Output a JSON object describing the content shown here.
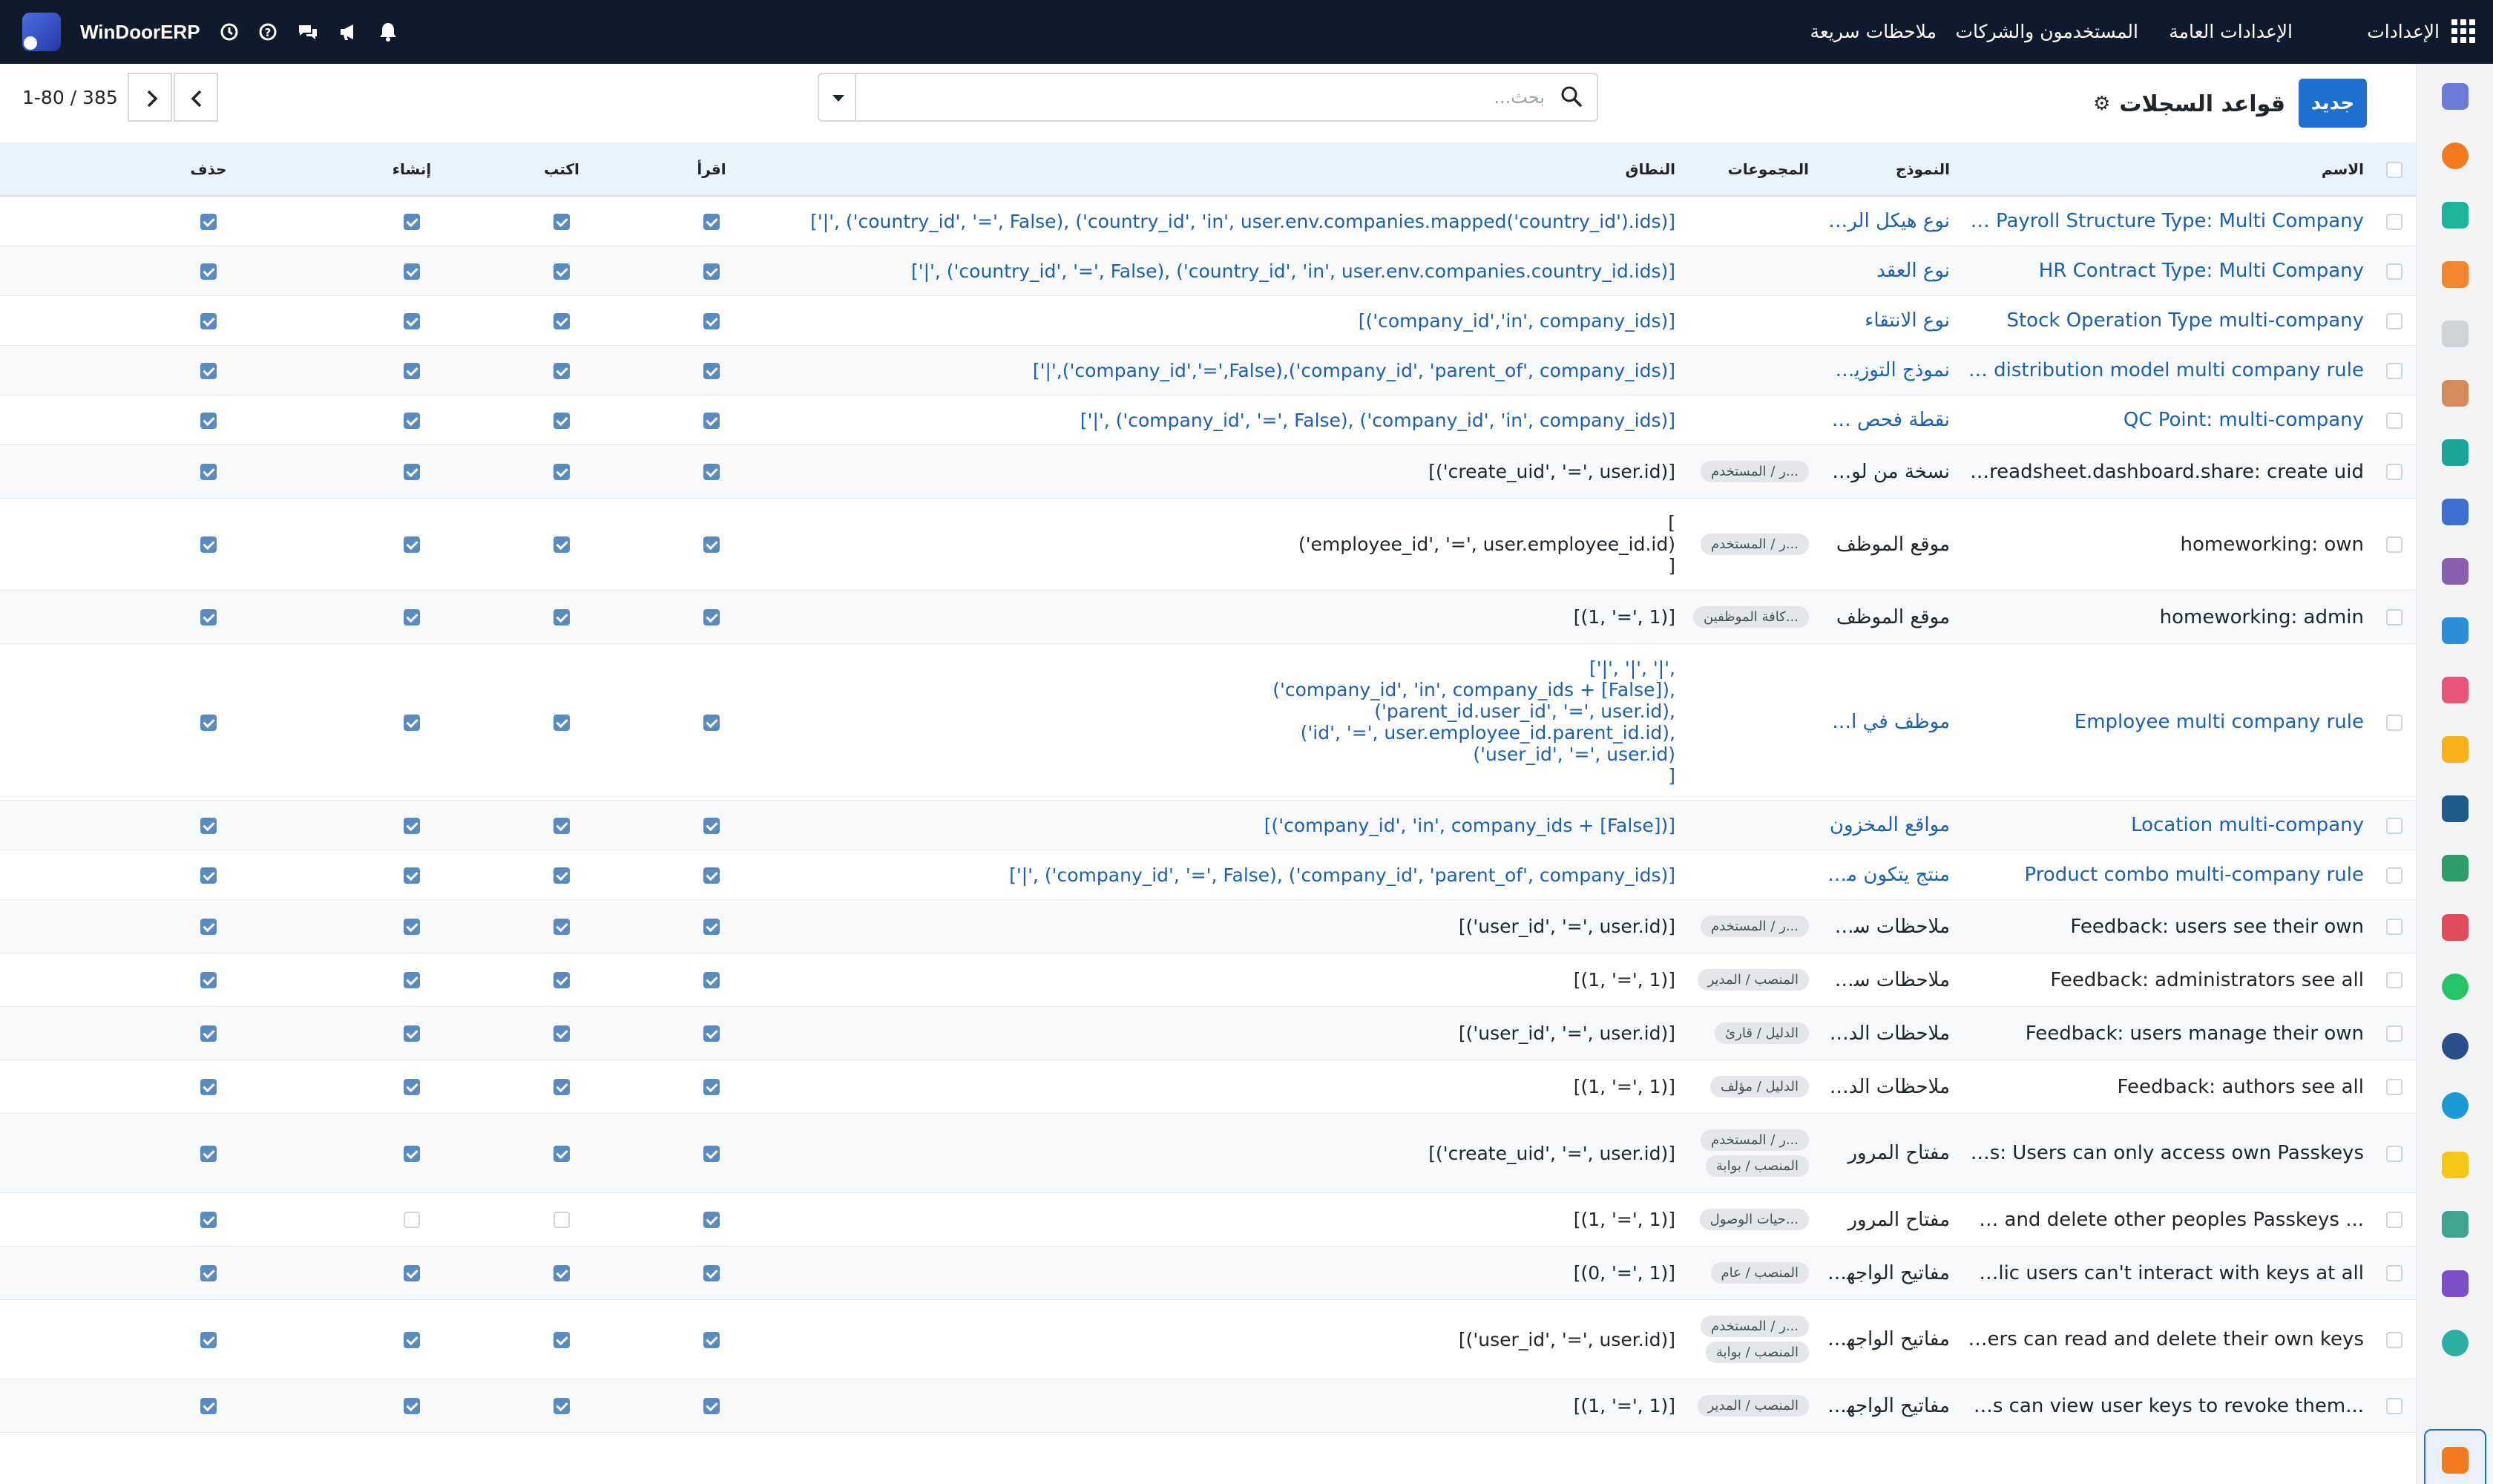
{
  "topbar": {
    "settings_label": "الإعدادات",
    "menu": [
      "الإعدادات العامة",
      "المستخدمون والشركات",
      "ملاحظات سريعة"
    ],
    "brand": "WinDoorERP"
  },
  "control": {
    "new_label": "جديد",
    "title": "قواعد السجلات",
    "search_placeholder": "بحث...",
    "pager_value": "1-80 / 385"
  },
  "columns": {
    "name": "الاسم",
    "model": "النموذج",
    "groups": "المجموعات",
    "domain": "النطاق",
    "read": "اقرأ",
    "write": "اكتب",
    "create": "إنشاء",
    "delete": "حذف"
  },
  "colors": {
    "topbar_bg": "#0f1a2b",
    "primary": "#1f6fd0",
    "link": "#1b5fb5",
    "header_bg": "#e9f3fd"
  },
  "rows": [
    {
      "name": "HR Payroll Structure Type: Multi Company",
      "model": "نوع هيكل الراتب",
      "groups": [],
      "domain": [
        "['|', ('country_id', '=', False), ('country_id', 'in', user.env.companies.mapped('country_id').ids)]"
      ],
      "read": true,
      "write": true,
      "create": true,
      "delete": true,
      "link": true
    },
    {
      "name": "HR Contract Type: Multi Company",
      "model": "نوع العقد",
      "groups": [],
      "domain": [
        "['|', ('country_id', '=', False), ('country_id', 'in', user.env.companies.country_id.ids)]"
      ],
      "read": true,
      "write": true,
      "create": true,
      "delete": true,
      "link": true
    },
    {
      "name": "Stock Operation Type multi-company",
      "model": "نوع الانتقاء",
      "groups": [],
      "domain": [
        "[('company_id','in', company_ids)]"
      ],
      "read": true,
      "write": true,
      "create": true,
      "delete": true,
      "link": true
    },
    {
      "name": "Analytic distribution model multi company rule",
      "model": "نموذج التوزيع الـ...",
      "groups": [],
      "domain": [
        "['|',('company_id','=',False),('company_id', 'parent_of', company_ids)]"
      ],
      "read": true,
      "write": true,
      "create": true,
      "delete": true,
      "link": true
    },
    {
      "name": "QC Point: multi-company",
      "model": "نقطة فحص جو...",
      "groups": [],
      "domain": [
        "['|', ('company_id', '=', False), ('company_id', 'in', company_ids)]"
      ],
      "read": true,
      "write": true,
      "create": true,
      "delete": true,
      "link": true
    },
    {
      "name": "spreadsheet.dashboard.share: create uid",
      "model": "نسخة من لوحة...",
      "groups": [
        "...ر / المستخدم"
      ],
      "domain": [
        "[('create_uid', '=', user.id)]"
      ],
      "read": true,
      "write": true,
      "create": true,
      "delete": true,
      "link": false
    },
    {
      "name": "homeworking: own",
      "model": "موقع الموظف",
      "groups": [
        "...ر / المستخدم"
      ],
      "domain": [
        "[",
        "('employee_id', '=', user.employee_id.id)",
        "]"
      ],
      "read": true,
      "write": true,
      "create": true,
      "delete": true,
      "link": false
    },
    {
      "name": "homeworking: admin",
      "model": "موقع الموظف",
      "groups": [
        "...كافة الموظفين"
      ],
      "domain": [
        "[(1, '=', 1)]"
      ],
      "read": true,
      "write": true,
      "create": true,
      "delete": true,
      "link": false
    },
    {
      "name": "Employee multi company rule",
      "model": "موظف في القطا...",
      "groups": [],
      "domain": [
        "['|', '|', '|',",
        "('company_id', 'in', company_ids + [False]),",
        "('parent_id.user_id', '=', user.id),",
        "('id', '=', user.employee_id.parent_id.id),",
        "('user_id', '=', user.id)",
        "]"
      ],
      "read": true,
      "write": true,
      "create": true,
      "delete": true,
      "link": true
    },
    {
      "name": "Location multi-company",
      "model": "مواقع المخزون",
      "groups": [],
      "domain": [
        "[('company_id', 'in', company_ids + [False])]"
      ],
      "read": true,
      "write": true,
      "create": true,
      "delete": true,
      "link": true
    },
    {
      "name": "Product combo multi-company rule",
      "model": "منتج يتكون من ...",
      "groups": [],
      "domain": [
        "['|', ('company_id', '=', False), ('company_id', 'parent_of', company_ids)]"
      ],
      "read": true,
      "write": true,
      "create": true,
      "delete": true,
      "link": true
    },
    {
      "name": "Feedback: users see their own",
      "model": "ملاحظات سريعة",
      "groups": [
        "...ر / المستخدم"
      ],
      "domain": [
        "[('user_id', '=', user.id)]"
      ],
      "read": true,
      "write": true,
      "create": true,
      "delete": true,
      "link": false
    },
    {
      "name": "Feedback: administrators see all",
      "model": "ملاحظات سريعة",
      "groups": [
        "المنصب / المدير"
      ],
      "domain": [
        "[(1, '=', 1)]"
      ],
      "read": true,
      "write": true,
      "create": true,
      "delete": true,
      "link": false
    },
    {
      "name": "Feedback: users manage their own",
      "model": "ملاحظات الدليل",
      "groups": [
        "الدليل / قارئ"
      ],
      "domain": [
        "[('user_id', '=', user.id)]"
      ],
      "read": true,
      "write": true,
      "create": true,
      "delete": true,
      "link": false
    },
    {
      "name": "Feedback: authors see all",
      "model": "ملاحظات الدليل",
      "groups": [
        "الدليل / مؤلف"
      ],
      "domain": [
        "[(1, '=', 1)]"
      ],
      "read": true,
      "write": true,
      "create": true,
      "delete": true,
      "link": false
    },
    {
      "name": "Passkeys: Users can only access own Passkeys...",
      "model": "مفتاح المرور",
      "groups": [
        "...ر / المستخدم",
        "المنصب / بوابة"
      ],
      "domain": [
        "[('create_uid', '=', user.id)]"
      ],
      "read": true,
      "write": true,
      "create": true,
      "delete": true,
      "link": false
    },
    {
      "name": "... can view and delete other peoples Passkeys",
      "model": "مفتاح المرور",
      "groups": [
        "...حيات الوصول"
      ],
      "domain": [
        "[(1, '=', 1)]"
      ],
      "read": true,
      "write": false,
      "create": false,
      "delete": true,
      "link": false
    },
    {
      "name": "Public users can't interact with keys at all",
      "model": "مفاتيح الواجهة ...",
      "groups": [
        "المنصب / عام"
      ],
      "domain": [
        "[(0, '=', 1)]"
      ],
      "read": true,
      "write": true,
      "create": true,
      "delete": true,
      "link": false
    },
    {
      "name": "Users can read and delete their own keys",
      "model": "مفاتيح الواجهة ...",
      "groups": [
        "...ر / المستخدم",
        "المنصب / بوابة"
      ],
      "domain": [
        "[('user_id', '=', user.id)]"
      ],
      "read": true,
      "write": true,
      "create": true,
      "delete": true,
      "link": false
    },
    {
      "name": "...inistrators can view user keys to revoke them",
      "model": "مفاتيح الواجهة ...",
      "groups": [
        "المنصب / المدير"
      ],
      "domain": [
        "[(1, '=', 1)]"
      ],
      "read": true,
      "write": true,
      "create": true,
      "delete": true,
      "link": false
    }
  ]
}
